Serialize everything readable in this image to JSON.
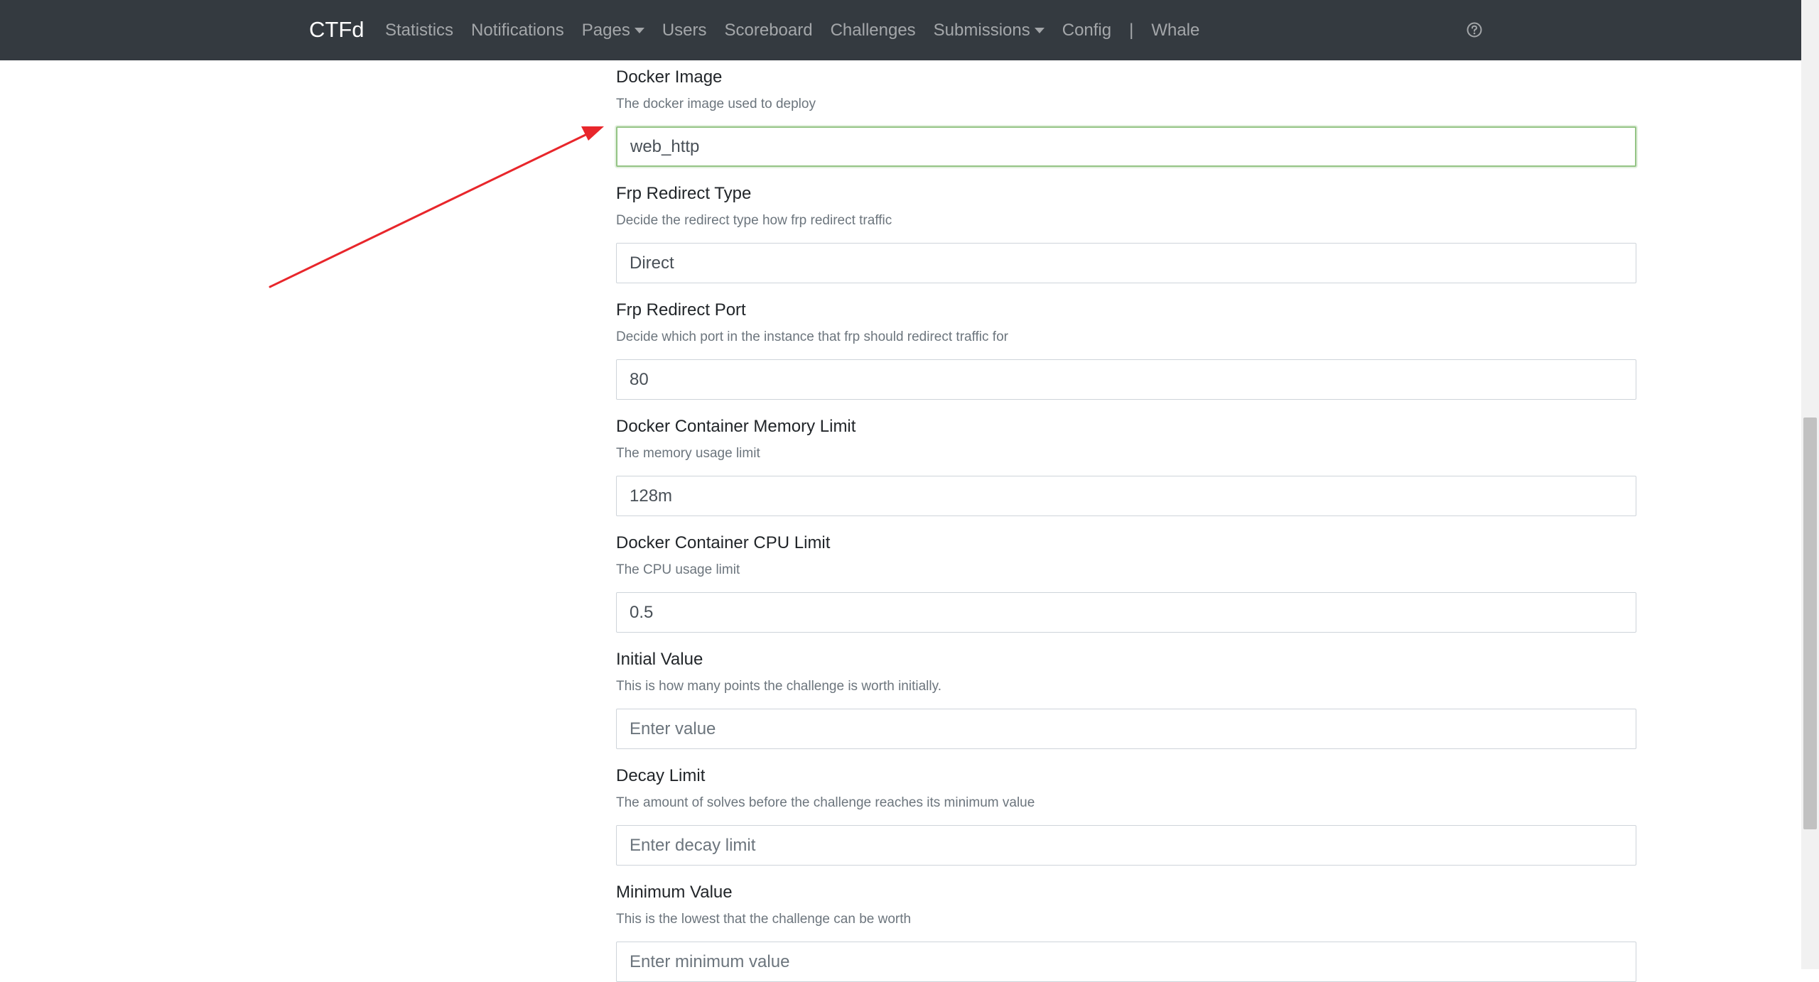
{
  "navbar": {
    "brand": "CTFd",
    "items": [
      {
        "label": "Statistics"
      },
      {
        "label": "Notifications"
      },
      {
        "label": "Pages",
        "dropdown": true
      },
      {
        "label": "Users"
      },
      {
        "label": "Scoreboard"
      },
      {
        "label": "Challenges"
      },
      {
        "label": "Submissions",
        "dropdown": true
      },
      {
        "label": "Config"
      },
      {
        "label": "|"
      },
      {
        "label": "Whale"
      }
    ],
    "help_icon": "question-circle-icon"
  },
  "form": {
    "fields": [
      {
        "label": "Docker Image",
        "help": "The docker image used to deploy",
        "value": "web_http",
        "placeholder": "",
        "focused": true
      },
      {
        "label": "Frp Redirect Type",
        "help": "Decide the redirect type how frp redirect traffic",
        "value": "Direct",
        "placeholder": ""
      },
      {
        "label": "Frp Redirect Port",
        "help": "Decide which port in the instance that frp should redirect traffic for",
        "value": "80",
        "placeholder": ""
      },
      {
        "label": "Docker Container Memory Limit",
        "help": "The memory usage limit",
        "value": "128m",
        "placeholder": ""
      },
      {
        "label": "Docker Container CPU Limit",
        "help": "The CPU usage limit",
        "value": "0.5",
        "placeholder": ""
      },
      {
        "label": "Initial Value",
        "help": "This is how many points the challenge is worth initially.",
        "value": "",
        "placeholder": "Enter value"
      },
      {
        "label": "Decay Limit",
        "help": "The amount of solves before the challenge reaches its minimum value",
        "value": "",
        "placeholder": "Enter decay limit"
      },
      {
        "label": "Minimum Value",
        "help": "This is the lowest that the challenge can be worth",
        "value": "",
        "placeholder": "Enter minimum value"
      }
    ]
  },
  "colors": {
    "navbar_bg": "#343a40",
    "focus_border": "#94c485",
    "annotation_arrow": "#e8262b"
  }
}
